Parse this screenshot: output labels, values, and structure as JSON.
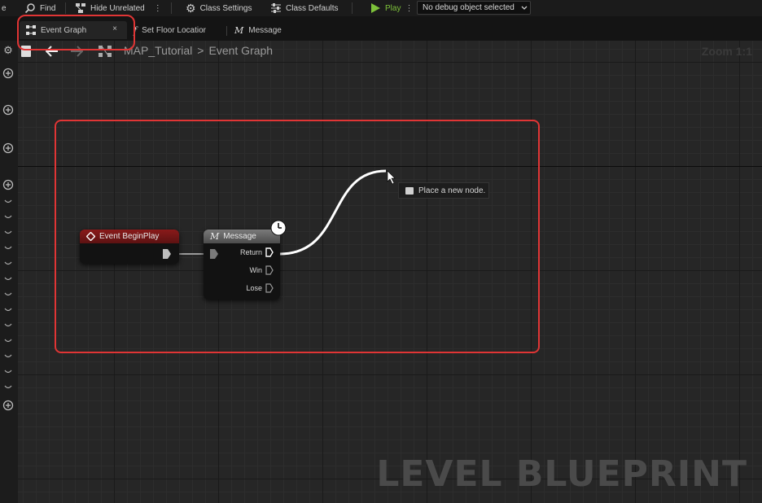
{
  "toolbar": {
    "find_label": "Find",
    "hide_unrelated_label": "Hide Unrelated",
    "class_settings_label": "Class Settings",
    "class_defaults_label": "Class Defaults",
    "play_label": "Play",
    "debug_selector_value": "No debug object selected"
  },
  "tabs": [
    {
      "label": "Event Graph",
      "icon": "event-graph-icon",
      "active": true,
      "close": "×"
    },
    {
      "label": "Set Floor Locatior",
      "icon": "function-icon",
      "active": false
    },
    {
      "label": "Message",
      "icon": "macro-icon",
      "active": false
    }
  ],
  "breadcrumb": {
    "root": "MAP_Tutorial",
    "separator": ">",
    "current": "Event Graph"
  },
  "zoom_label": "Zoom 1:1",
  "nodes": {
    "event_begin_play": {
      "title": "Event BeginPlay",
      "color": "#8a1a1a"
    },
    "message": {
      "title": "Message",
      "color": "#5a5a5a",
      "pins": [
        "Return",
        "Win",
        "Lose"
      ]
    }
  },
  "tooltip": {
    "text": "Place a new node."
  },
  "watermark": "LEVEL BLUEPRINT",
  "colors": {
    "highlight": "#e03535",
    "play": "#7dc13a",
    "wire": "#ffffff"
  }
}
